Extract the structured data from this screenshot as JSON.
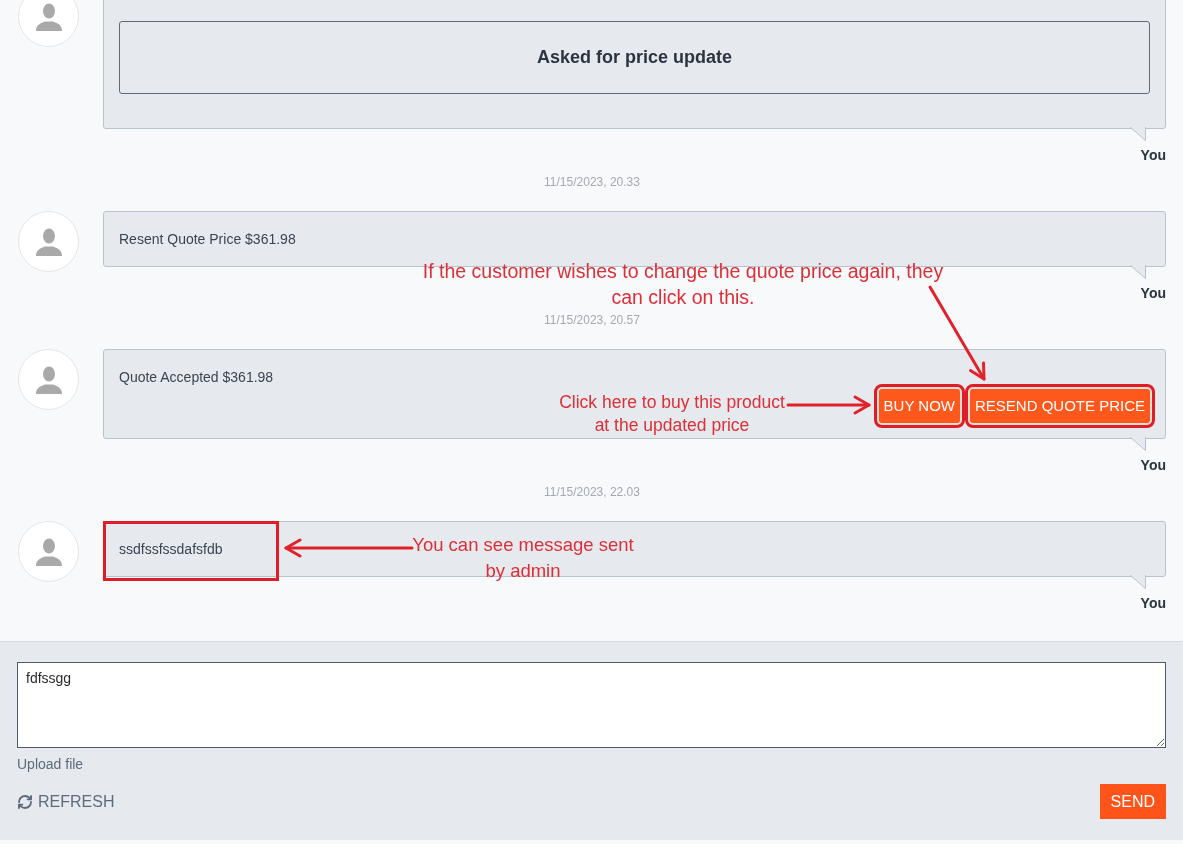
{
  "thread": [
    {
      "kind": "card",
      "title": "Asked for price update",
      "sender": "You"
    },
    {
      "kind": "timestamp",
      "text": "11/15/2023, 20.33"
    },
    {
      "kind": "message",
      "text": "Resent Quote Price $361.98",
      "sender": "You",
      "highlighted": false
    },
    {
      "kind": "timestamp",
      "text": "11/15/2023, 20.57"
    },
    {
      "kind": "message",
      "text": "Quote Accepted $361.98",
      "sender": "You",
      "highlighted": false,
      "buttons": [
        {
          "label": "BUY NOW",
          "highlighted": true
        },
        {
          "label": "RESEND QUOTE PRICE",
          "highlighted": true
        }
      ]
    },
    {
      "kind": "timestamp",
      "text": "11/15/2023, 22.03"
    },
    {
      "kind": "message",
      "text": "ssdfssfssdafsfdb",
      "sender": "You",
      "highlighted": true
    }
  ],
  "annotations": [
    {
      "text": "If the customer wishes to change the quote price again, they\ncan click on this."
    },
    {
      "text": "Click here to buy this product\nat the updated price"
    },
    {
      "text": "You can see message sent\nby admin"
    }
  ],
  "composer": {
    "value": "fdfssgg",
    "upload_label": "Upload file",
    "refresh_label": "REFRESH",
    "send_label": "SEND"
  }
}
